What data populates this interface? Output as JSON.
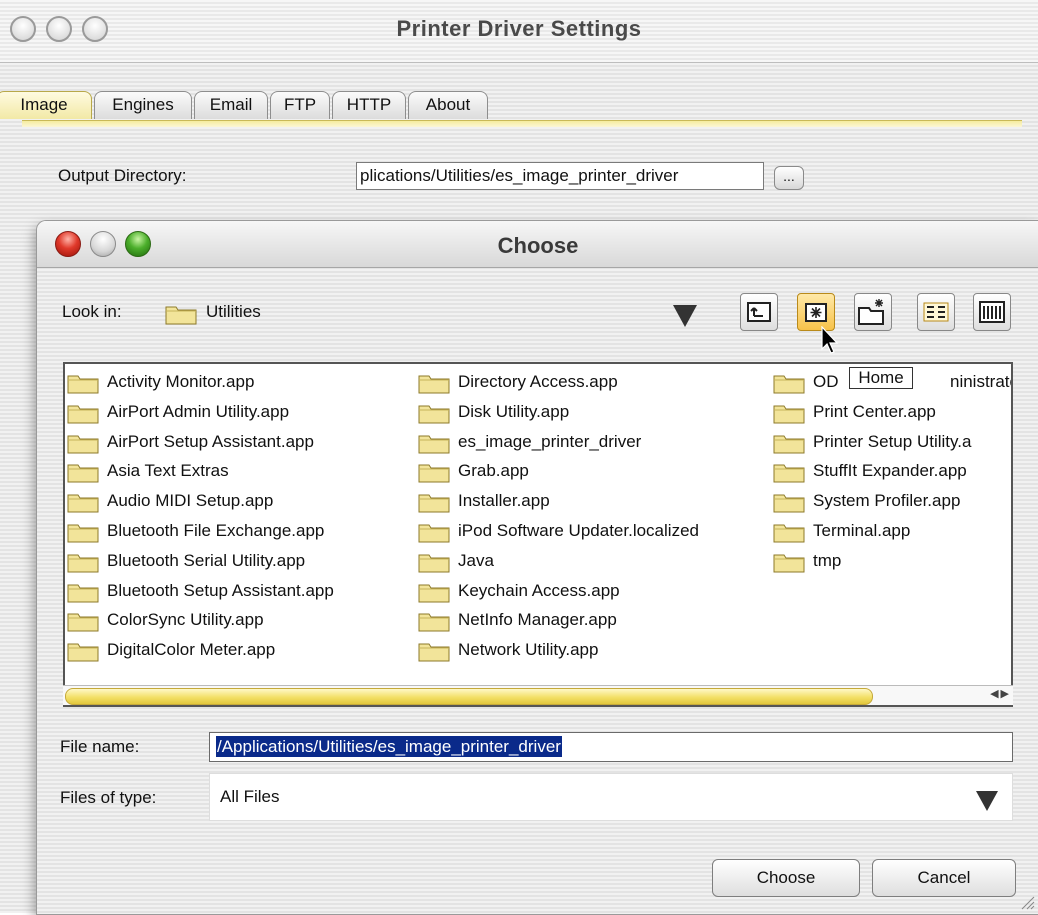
{
  "outer_window": {
    "title": "Printer Driver Settings",
    "tabs": [
      {
        "label": "Image",
        "active": true
      },
      {
        "label": "Engines",
        "active": false
      },
      {
        "label": "Email",
        "active": false
      },
      {
        "label": "FTP",
        "active": false
      },
      {
        "label": "HTTP",
        "active": false
      },
      {
        "label": "About",
        "active": false
      }
    ],
    "output_directory": {
      "label": "Output Directory:",
      "value": "plications/Utilities/es_image_printer_driver",
      "browse_label": "..."
    }
  },
  "dialog": {
    "title": "Choose",
    "look_in": {
      "label": "Look in:",
      "value": "Utilities"
    },
    "toolbar": {
      "up": "up-folder-icon",
      "home": "home-folder-icon",
      "new_folder": "new-folder-icon",
      "list_view": "list-view-icon",
      "details_view": "details-view-icon"
    },
    "tooltip": "Home",
    "files": {
      "col1": [
        "Activity Monitor.app",
        "AirPort Admin Utility.app",
        "AirPort Setup Assistant.app",
        "Asia Text Extras",
        "Audio MIDI Setup.app",
        "Bluetooth File Exchange.app",
        "Bluetooth Serial Utility.app",
        "Bluetooth Setup Assistant.app",
        "ColorSync Utility.app",
        "DigitalColor Meter.app"
      ],
      "col2": [
        "Directory Access.app",
        "Disk Utility.app",
        "es_image_printer_driver",
        "Grab.app",
        "Installer.app",
        "iPod Software Updater.localized",
        "Java",
        "Keychain Access.app",
        "NetInfo Manager.app",
        "Network Utility.app"
      ],
      "col3": [
        "OD",
        "Print Center.app",
        "Printer Setup Utility.a",
        "StuffIt Expander.app",
        "System Profiler.app",
        "Terminal.app",
        "tmp"
      ],
      "col3_suffix": "ninistrator"
    },
    "file_name": {
      "label": "File name:",
      "value": "/Applications/Utilities/es_image_printer_driver"
    },
    "files_of_type": {
      "label": "Files of type:",
      "value": "All Files"
    },
    "buttons": {
      "choose": "Choose",
      "cancel": "Cancel"
    },
    "colors": {
      "selection": "#0a2a8a",
      "accent_yellow": "#f3e067",
      "close": "#e0392b",
      "zoom": "#4caf2c"
    }
  }
}
